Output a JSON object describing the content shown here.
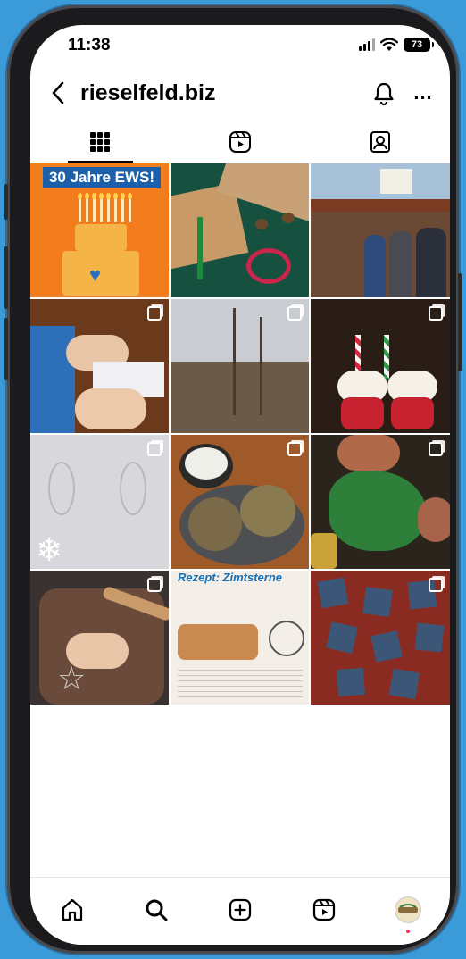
{
  "status_bar": {
    "time": "11:38",
    "battery": "73"
  },
  "header": {
    "username": "rieselfeld.biz"
  },
  "icons": {
    "back": "chevron-left-icon",
    "bell": "bell-icon",
    "more": "more-icon",
    "tab_grid": "grid-icon",
    "tab_reels": "reels-icon",
    "tab_tagged": "tagged-person-icon",
    "nav_home": "home-icon",
    "nav_search": "search-icon",
    "nav_add": "add-post-icon",
    "nav_reels": "reels-icon"
  },
  "header_more": "...",
  "posts": {
    "p1_banner": "30 Jahre EWS!",
    "p11_title": "Rezept: Zimtsterne"
  },
  "colors": {
    "accent_blue": "#3b9ad8",
    "notification_dot": "#ff2d55"
  }
}
